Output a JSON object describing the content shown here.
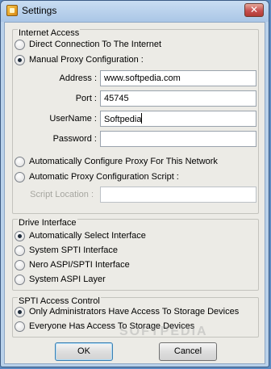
{
  "window": {
    "title": "Settings",
    "close_glyph": "✕"
  },
  "internet_access": {
    "title": "Internet Access",
    "options": [
      {
        "label": "Direct Connection To The Internet",
        "checked": false
      },
      {
        "label": "Manual Proxy Configuration :",
        "checked": true
      }
    ],
    "fields": {
      "address_label": "Address :",
      "address_value": "www.softpedia.com",
      "port_label": "Port :",
      "port_value": "45745",
      "username_label": "UserName :",
      "username_value": "Softpedia",
      "password_label": "Password :",
      "password_value": ""
    },
    "auto_options": [
      {
        "label": "Automatically Configure Proxy For This Network",
        "checked": false
      },
      {
        "label": "Automatic Proxy Configuration Script :",
        "checked": false
      }
    ],
    "script_location_label": "Script Location :",
    "script_location_value": ""
  },
  "drive_interface": {
    "title": "Drive Interface",
    "options": [
      {
        "label": "Automatically Select Interface",
        "checked": true
      },
      {
        "label": "System SPTI Interface",
        "checked": false
      },
      {
        "label": "Nero ASPI/SPTI Interface",
        "checked": false
      },
      {
        "label": "System ASPI Layer",
        "checked": false
      }
    ]
  },
  "spti_access": {
    "title": "SPTI Access Control",
    "options": [
      {
        "label": "Only Administrators Have Access To Storage Devices",
        "checked": true
      },
      {
        "label": "Everyone Has Access To Storage Devices",
        "checked": false
      }
    ]
  },
  "buttons": {
    "ok": "OK",
    "cancel": "Cancel"
  },
  "watermark": "SOFTPEDIA"
}
